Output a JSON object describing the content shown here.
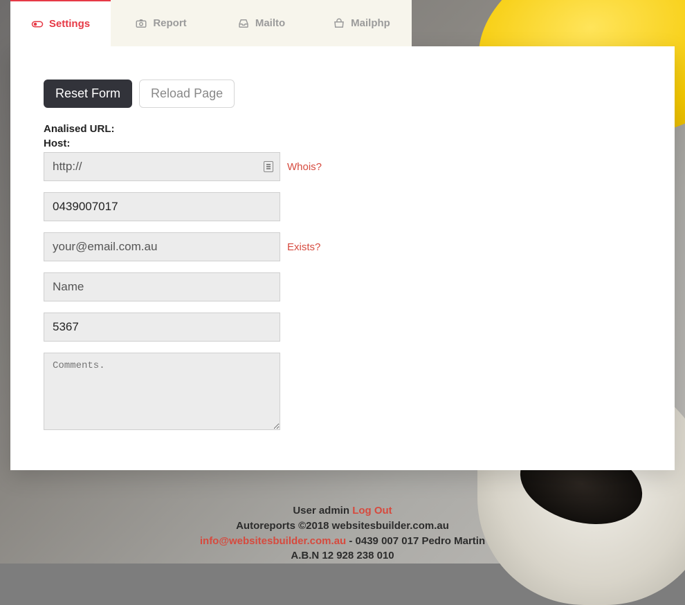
{
  "tabs": [
    {
      "label": "Settings"
    },
    {
      "label": "Report"
    },
    {
      "label": "Mailto"
    },
    {
      "label": "Mailphp"
    }
  ],
  "buttons": {
    "reset": "Reset Form",
    "reload": "Reload Page"
  },
  "labels": {
    "analised_url": "Analised URL:",
    "host": "Host:"
  },
  "fields": {
    "host_placeholder": "http://",
    "phone_value": "0439007017",
    "email_placeholder": "your@email.com.au",
    "name_placeholder": "Name",
    "pin_value": "5367",
    "comments_placeholder": "Comments."
  },
  "links": {
    "whois": "Whois?",
    "exists": "Exists?"
  },
  "footer": {
    "line1_pre": "User admin ",
    "logout": "Log Out",
    "line2": "Autoreports ©2018 websitesbuilder.com.au",
    "line3_email": "info@websitesbuilder.com.au",
    "line3_rest": " - 0439 007 017 Pedro Martin",
    "line4": "A.B.N 12 928 238 010"
  }
}
